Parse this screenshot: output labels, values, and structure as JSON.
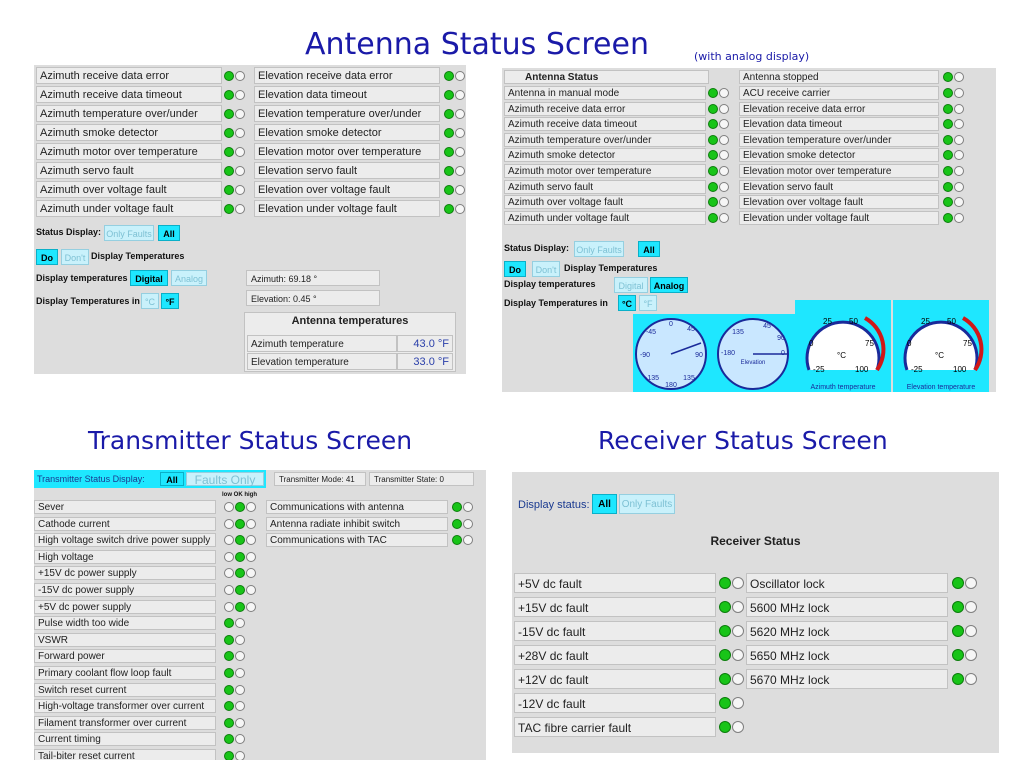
{
  "titles": {
    "antenna": "Antenna Status Screen",
    "antenna_sub": "(with analog display)",
    "transmitter": "Transmitter Status Screen",
    "receiver": "Receiver Status Screen"
  },
  "ant1": {
    "rows": [
      {
        "az": "Azimuth receive data error",
        "el": "Elevation receive data error"
      },
      {
        "az": "Azimuth receive data timeout",
        "el": "Elevation data timeout"
      },
      {
        "az": "Azimuth temperature over/under",
        "el": "Elevation temperature over/under"
      },
      {
        "az": "Azimuth smoke detector",
        "el": "Elevation smoke detector"
      },
      {
        "az": "Azimuth motor over temperature",
        "el": "Elevation motor over temperature"
      },
      {
        "az": "Azimuth servo fault",
        "el": "Elevation servo fault"
      },
      {
        "az": "Azimuth over voltage fault",
        "el": "Elevation over voltage fault"
      },
      {
        "az": "Azimuth under voltage fault",
        "el": "Elevation under voltage fault"
      }
    ],
    "status_display_label": "Status Display:",
    "only_faults": "Only Faults",
    "all": "All",
    "do": "Do",
    "dont": "Don't",
    "display_temps_label": "Display Temperatures",
    "display_temps_mode_label": "Display temperatures",
    "digital": "Digital",
    "analog": "Analog",
    "temps_in_label": "Display Temperatures in",
    "deg_c": "°C",
    "deg_f": "°F",
    "azimuth_value": "Azimuth: 69.18 °",
    "elevation_value": "Elevation: 0.45 °",
    "temps_header": "Antenna temperatures",
    "az_temp_label": "Azimuth temperature",
    "az_temp_value": "43.0 °F",
    "el_temp_label": "Elevation temperature",
    "el_temp_value": "33.0 °F"
  },
  "ant2": {
    "header_left": "Antenna Status",
    "header_right": "Antenna stopped",
    "rows": [
      {
        "az": "Antenna in manual mode",
        "el": "ACU receive carrier"
      },
      {
        "az": "Azimuth receive data error",
        "el": "Elevation receive data error"
      },
      {
        "az": "Azimuth receive data timeout",
        "el": "Elevation data timeout"
      },
      {
        "az": "Azimuth temperature over/under",
        "el": "Elevation temperature over/under"
      },
      {
        "az": "Azimuth smoke detector",
        "el": "Elevation smoke detector"
      },
      {
        "az": "Azimuth motor over temperature",
        "el": "Elevation motor over temperature"
      },
      {
        "az": "Azimuth servo fault",
        "el": "Elevation servo fault"
      },
      {
        "az": "Azimuth over voltage fault",
        "el": "Elevation over voltage fault"
      },
      {
        "az": "Azimuth under voltage fault",
        "el": "Elevation under voltage fault"
      }
    ],
    "status_display_label": "Status Display:",
    "only_faults": "Only Faults",
    "all": "All",
    "do": "Do",
    "dont": "Don't",
    "display_temps_label": "Display Temperatures",
    "display_temps_mode_label": "Display temperatures",
    "digital": "Digital",
    "analog": "Analog",
    "temps_in_label": "Display Temperatures in",
    "deg_c": "°C",
    "deg_f": "°F",
    "compass_ticks": [
      "0",
      "45",
      "90",
      "135",
      "180",
      "-135",
      "-90",
      "-45"
    ],
    "compass_el_ticks": [
      "45",
      "90",
      "135",
      "-180",
      "0"
    ],
    "compass_el_label": "Elevation",
    "temp_ticks": [
      "-25",
      "0",
      "25",
      "50",
      "75",
      "100"
    ],
    "temp_unit": "°C",
    "az_gauge_label": "Azimuth temperature",
    "el_gauge_label": "Elevation temperature"
  },
  "tx": {
    "title": "Transmitter Status Display:",
    "all": "All",
    "faults_only": "Faults Only",
    "mode_label": "Transmitter Mode: 41",
    "state_label": "Transmitter State: 0",
    "led_header": "low OK high",
    "rows3": [
      "Sever",
      "Cathode current",
      "High voltage switch drive power supply",
      "High voltage",
      "+15V dc power supply",
      "-15V dc power supply",
      "+5V dc power supply"
    ],
    "rows2": [
      "Pulse width too wide",
      "VSWR",
      "Forward power",
      "Primary coolant flow loop fault",
      "Switch reset current",
      "High-voltage transformer over current",
      "Filament transformer over current",
      "Current timing",
      "Tail-biter reset current"
    ],
    "right_rows": [
      "Communications with antenna",
      "Antenna radiate inhibit switch",
      "Communications with TAC"
    ]
  },
  "rx": {
    "display_status_label": "Display status:",
    "all": "All",
    "only_faults": "Only Faults",
    "header": "Receiver Status",
    "left": [
      "+5V dc fault",
      "+15V dc fault",
      "-15V dc fault",
      "+28V dc fault",
      "+12V dc fault",
      "-12V dc fault",
      "TAC fibre carrier fault"
    ],
    "right": [
      "Oscillator lock",
      "5600 MHz lock",
      "5620 MHz lock",
      "5650 MHz lock",
      "5670 MHz lock"
    ]
  }
}
